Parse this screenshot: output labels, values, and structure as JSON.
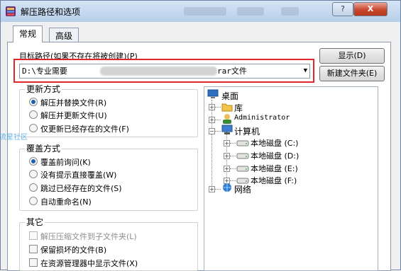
{
  "window": {
    "title": "解压路径和选项",
    "help_label": "?",
    "close_label": "X"
  },
  "tabs": [
    {
      "label": "常规",
      "active": true
    },
    {
      "label": "高级",
      "active": false
    }
  ],
  "destination": {
    "label": "目标路径(如果不存在将被创建)(P)",
    "path_start": "D:\\专业需要",
    "path_end": "rar文件",
    "dropdown_icon": "down-arrow-icon"
  },
  "buttons": {
    "show": "显示(D)",
    "new_folder": "新建文件夹(E)"
  },
  "update_mode": {
    "title": "更新方式",
    "options": [
      {
        "label": "解压并替换文件(R)",
        "selected": true
      },
      {
        "label": "解压并更新文件(U)",
        "selected": false
      },
      {
        "label": "仅更新已经存在的文件(F)",
        "selected": false
      }
    ]
  },
  "overwrite_mode": {
    "title": "覆盖方式",
    "options": [
      {
        "label": "覆盖前询问(K)",
        "selected": true
      },
      {
        "label": "没有提示直接覆盖(W)",
        "selected": false
      },
      {
        "label": "跳过已经存在的文件(S)",
        "selected": false
      },
      {
        "label": "自动重命名(N)",
        "selected": false
      }
    ]
  },
  "misc": {
    "title": "其它",
    "options": [
      {
        "label": "解压压缩文件到子文件夹(L)",
        "checked": false,
        "disabled": true
      },
      {
        "label": "保留损坏的文件(B)",
        "checked": false,
        "disabled": false
      },
      {
        "label": "在资源管理器中显示文件(X)",
        "checked": false,
        "disabled": false
      }
    ]
  },
  "folder_tree": {
    "root": "桌面",
    "items": [
      {
        "label": "库",
        "icon": "library-icon"
      },
      {
        "label": "Administrator",
        "icon": "user-icon"
      },
      {
        "label": "计算机",
        "icon": "computer-icon"
      },
      {
        "label": "本地磁盘 (C:)",
        "icon": "drive-icon"
      },
      {
        "label": "本地磁盘 (D:)",
        "icon": "drive-icon"
      },
      {
        "label": "本地磁盘 (E:)",
        "icon": "drive-icon"
      },
      {
        "label": "本地磁盘 (F:)",
        "icon": "drive-icon"
      },
      {
        "label": "网络",
        "icon": "network-icon"
      }
    ]
  },
  "watermark": "流星社区",
  "colors": {
    "highlight": "#e0262a",
    "accent": "#1c5fb0"
  }
}
